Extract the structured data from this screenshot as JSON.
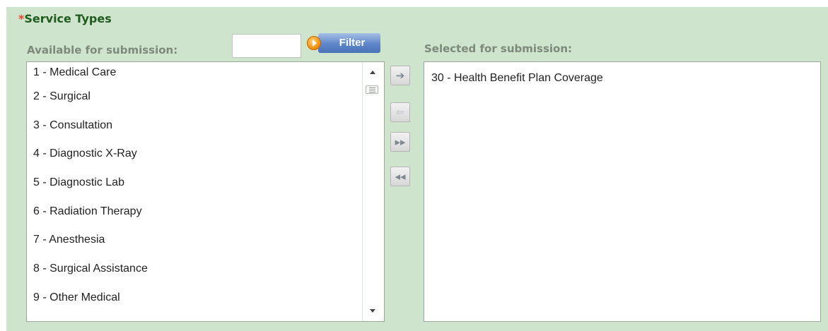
{
  "section": {
    "required_mark": "*",
    "title": "Service Types"
  },
  "available": {
    "label": "Available for submission:",
    "filter_value": "",
    "filter_button": "Filter",
    "items": [
      "1 - Medical Care",
      "2 - Surgical",
      "3 - Consultation",
      "4 - Diagnostic X-Ray",
      "5 - Diagnostic Lab",
      "6 - Radiation Therapy",
      "7 - Anesthesia",
      "8 - Surgical Assistance",
      "9 - Other Medical"
    ]
  },
  "controls": {
    "move_right": "➔",
    "move_left": "⇐",
    "move_all_right": "▸▸",
    "move_all_left": "◂◂"
  },
  "selected": {
    "label": "Selected for submission:",
    "items": [
      "30 - Health Benefit Plan Coverage"
    ]
  },
  "colors": {
    "panel_bg": "#cfe4cc",
    "title": "#1f5a1f",
    "required": "#e8462a",
    "filter_button": "#5e86c9"
  }
}
